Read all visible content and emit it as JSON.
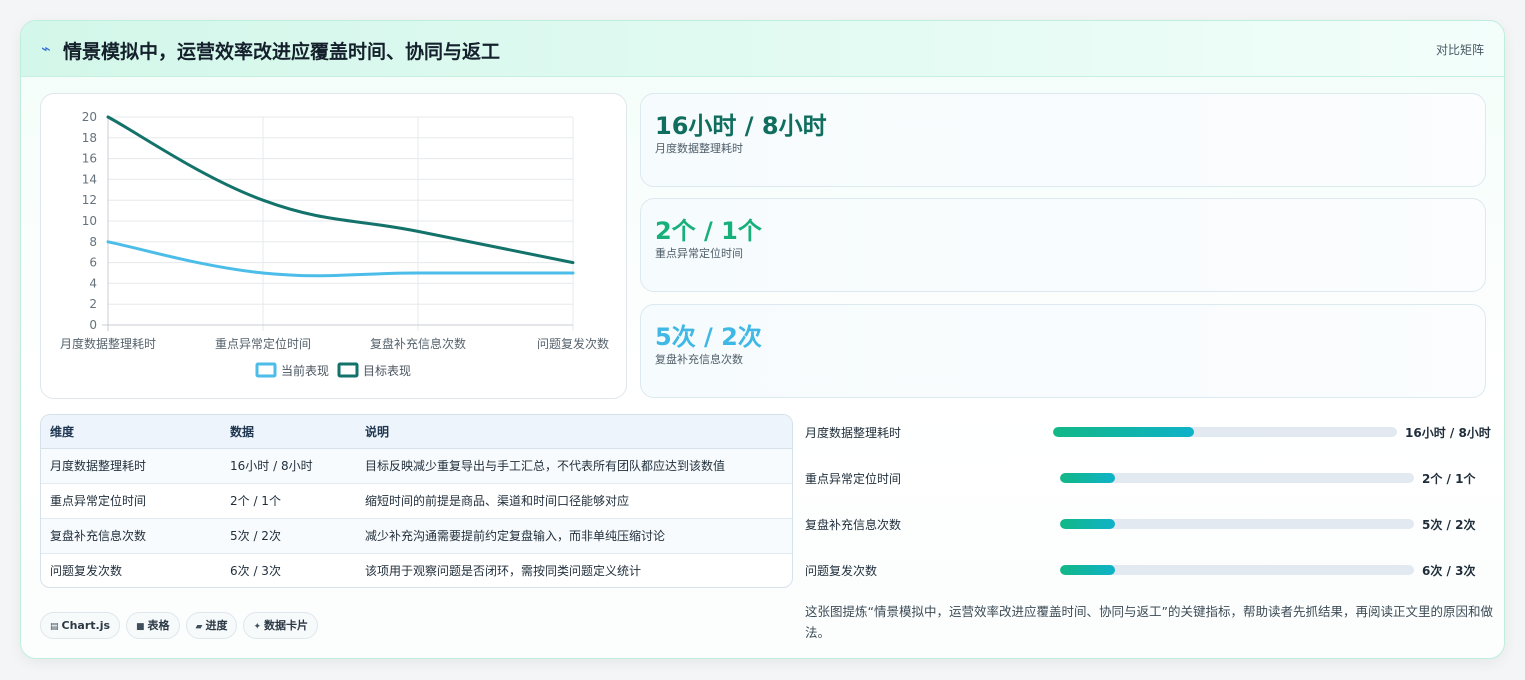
{
  "header": {
    "title": "情景模拟中，运营效率改进应覆盖时间、协同与返工",
    "right_label": "对比矩阵",
    "icon": "bolt-icon"
  },
  "chart_data": {
    "type": "line",
    "categories": [
      "月度数据整理耗时",
      "重点异常定位时间",
      "复盘补充信息次数",
      "问题复发次数"
    ],
    "series": [
      {
        "name": "当前表现",
        "values": [
          8,
          5,
          5,
          5
        ],
        "color": "#4bbde8"
      },
      {
        "name": "目标表现",
        "values": [
          20,
          12,
          9,
          6
        ],
        "color": "#13736a"
      }
    ],
    "yticks": [
      0,
      2,
      4,
      6,
      8,
      10,
      12,
      14,
      16,
      18,
      20
    ],
    "ylim": [
      0,
      20
    ],
    "grid": true,
    "legend": "bottom"
  },
  "kpis": [
    {
      "value": "16小时 / 8小时",
      "label": "月度数据整理耗时",
      "color": "#0f6e5e"
    },
    {
      "value": "2个 / 1个",
      "label": "重点异常定位时间",
      "color": "#17b07a"
    },
    {
      "value": "5次 / 2次",
      "label": "复盘补充信息次数",
      "color": "#3fb8e6"
    }
  ],
  "table": {
    "headers": [
      "维度",
      "数据",
      "说明"
    ],
    "rows": [
      [
        "月度数据整理耗时",
        "16小时 / 8小时",
        "目标反映减少重复导出与手工汇总，不代表所有团队都应达到该数值"
      ],
      [
        "重点异常定位时间",
        "2个 / 1个",
        "缩短时间的前提是商品、渠道和时间口径能够对应"
      ],
      [
        "复盘补充信息次数",
        "5次 / 2次",
        "减少补充沟通需要提前约定复盘输入，而非单纯压缩讨论"
      ],
      [
        "问题复发次数",
        "6次 / 3次",
        "该项用于观察问题是否闭环，需按同类问题定义统计"
      ]
    ]
  },
  "progress": [
    {
      "label": "月度数据整理耗时",
      "value": "16小时 / 8小时",
      "fraction": 0.41
    },
    {
      "label": "重点异常定位时间",
      "value": "2个 / 1个",
      "fraction": 0.155
    },
    {
      "label": "复盘补充信息次数",
      "value": "5次 / 2次",
      "fraction": 0.155
    },
    {
      "label": "问题复发次数",
      "value": "6次 / 3次",
      "fraction": 0.155
    }
  ],
  "note": "这张图提炼“情景模拟中，运营效率改进应覆盖时间、协同与返工”的关键指标，帮助读者先抓结果，再阅读正文里的原因和做法。",
  "tags": [
    {
      "icon": "chart-icon",
      "label": "Chart.js"
    },
    {
      "icon": "table-icon",
      "label": "表格"
    },
    {
      "icon": "progress-icon",
      "label": "进度"
    },
    {
      "icon": "sparkle-icon",
      "label": "数据卡片"
    }
  ]
}
